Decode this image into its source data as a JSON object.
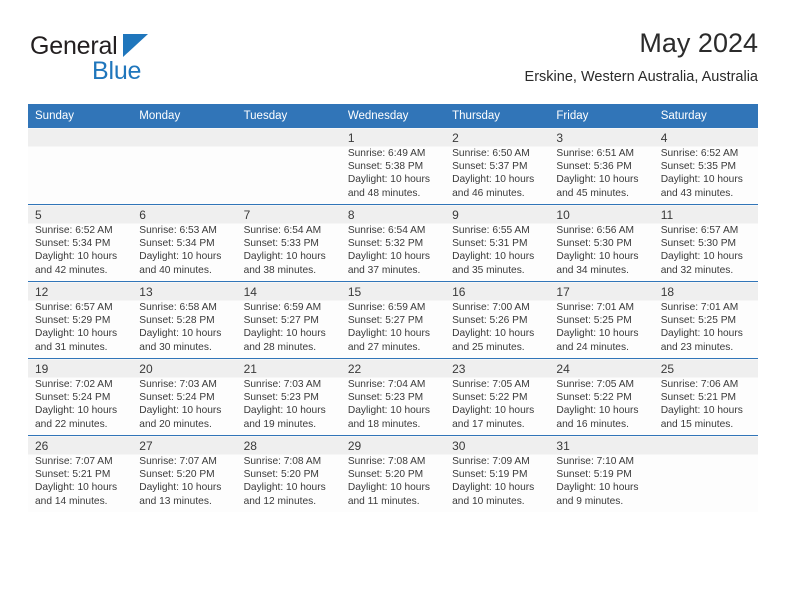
{
  "brand": {
    "name_part1": "General",
    "name_part2": "Blue",
    "triangle_icon": "triangle-icon"
  },
  "header": {
    "title": "May 2024",
    "subtitle": "Erskine, Western Australia, Australia"
  },
  "colors": {
    "header_blue": "#3175b8",
    "brand_blue": "#1f76bc",
    "row_band_gray": "#efefef",
    "text": "#3a3a3a"
  },
  "calendar": {
    "weekday_headers": [
      "Sunday",
      "Monday",
      "Tuesday",
      "Wednesday",
      "Thursday",
      "Friday",
      "Saturday"
    ],
    "weeks": [
      [
        {
          "day": "",
          "empty": true
        },
        {
          "day": "",
          "empty": true
        },
        {
          "day": "",
          "empty": true
        },
        {
          "day": "1",
          "sunrise": "Sunrise: 6:49 AM",
          "sunset": "Sunset: 5:38 PM",
          "daylight1": "Daylight: 10 hours",
          "daylight2": "and 48 minutes."
        },
        {
          "day": "2",
          "sunrise": "Sunrise: 6:50 AM",
          "sunset": "Sunset: 5:37 PM",
          "daylight1": "Daylight: 10 hours",
          "daylight2": "and 46 minutes."
        },
        {
          "day": "3",
          "sunrise": "Sunrise: 6:51 AM",
          "sunset": "Sunset: 5:36 PM",
          "daylight1": "Daylight: 10 hours",
          "daylight2": "and 45 minutes."
        },
        {
          "day": "4",
          "sunrise": "Sunrise: 6:52 AM",
          "sunset": "Sunset: 5:35 PM",
          "daylight1": "Daylight: 10 hours",
          "daylight2": "and 43 minutes."
        }
      ],
      [
        {
          "day": "5",
          "sunrise": "Sunrise: 6:52 AM",
          "sunset": "Sunset: 5:34 PM",
          "daylight1": "Daylight: 10 hours",
          "daylight2": "and 42 minutes."
        },
        {
          "day": "6",
          "sunrise": "Sunrise: 6:53 AM",
          "sunset": "Sunset: 5:34 PM",
          "daylight1": "Daylight: 10 hours",
          "daylight2": "and 40 minutes."
        },
        {
          "day": "7",
          "sunrise": "Sunrise: 6:54 AM",
          "sunset": "Sunset: 5:33 PM",
          "daylight1": "Daylight: 10 hours",
          "daylight2": "and 38 minutes."
        },
        {
          "day": "8",
          "sunrise": "Sunrise: 6:54 AM",
          "sunset": "Sunset: 5:32 PM",
          "daylight1": "Daylight: 10 hours",
          "daylight2": "and 37 minutes."
        },
        {
          "day": "9",
          "sunrise": "Sunrise: 6:55 AM",
          "sunset": "Sunset: 5:31 PM",
          "daylight1": "Daylight: 10 hours",
          "daylight2": "and 35 minutes."
        },
        {
          "day": "10",
          "sunrise": "Sunrise: 6:56 AM",
          "sunset": "Sunset: 5:30 PM",
          "daylight1": "Daylight: 10 hours",
          "daylight2": "and 34 minutes."
        },
        {
          "day": "11",
          "sunrise": "Sunrise: 6:57 AM",
          "sunset": "Sunset: 5:30 PM",
          "daylight1": "Daylight: 10 hours",
          "daylight2": "and 32 minutes."
        }
      ],
      [
        {
          "day": "12",
          "sunrise": "Sunrise: 6:57 AM",
          "sunset": "Sunset: 5:29 PM",
          "daylight1": "Daylight: 10 hours",
          "daylight2": "and 31 minutes."
        },
        {
          "day": "13",
          "sunrise": "Sunrise: 6:58 AM",
          "sunset": "Sunset: 5:28 PM",
          "daylight1": "Daylight: 10 hours",
          "daylight2": "and 30 minutes."
        },
        {
          "day": "14",
          "sunrise": "Sunrise: 6:59 AM",
          "sunset": "Sunset: 5:27 PM",
          "daylight1": "Daylight: 10 hours",
          "daylight2": "and 28 minutes."
        },
        {
          "day": "15",
          "sunrise": "Sunrise: 6:59 AM",
          "sunset": "Sunset: 5:27 PM",
          "daylight1": "Daylight: 10 hours",
          "daylight2": "and 27 minutes."
        },
        {
          "day": "16",
          "sunrise": "Sunrise: 7:00 AM",
          "sunset": "Sunset: 5:26 PM",
          "daylight1": "Daylight: 10 hours",
          "daylight2": "and 25 minutes."
        },
        {
          "day": "17",
          "sunrise": "Sunrise: 7:01 AM",
          "sunset": "Sunset: 5:25 PM",
          "daylight1": "Daylight: 10 hours",
          "daylight2": "and 24 minutes."
        },
        {
          "day": "18",
          "sunrise": "Sunrise: 7:01 AM",
          "sunset": "Sunset: 5:25 PM",
          "daylight1": "Daylight: 10 hours",
          "daylight2": "and 23 minutes."
        }
      ],
      [
        {
          "day": "19",
          "sunrise": "Sunrise: 7:02 AM",
          "sunset": "Sunset: 5:24 PM",
          "daylight1": "Daylight: 10 hours",
          "daylight2": "and 22 minutes."
        },
        {
          "day": "20",
          "sunrise": "Sunrise: 7:03 AM",
          "sunset": "Sunset: 5:24 PM",
          "daylight1": "Daylight: 10 hours",
          "daylight2": "and 20 minutes."
        },
        {
          "day": "21",
          "sunrise": "Sunrise: 7:03 AM",
          "sunset": "Sunset: 5:23 PM",
          "daylight1": "Daylight: 10 hours",
          "daylight2": "and 19 minutes."
        },
        {
          "day": "22",
          "sunrise": "Sunrise: 7:04 AM",
          "sunset": "Sunset: 5:23 PM",
          "daylight1": "Daylight: 10 hours",
          "daylight2": "and 18 minutes."
        },
        {
          "day": "23",
          "sunrise": "Sunrise: 7:05 AM",
          "sunset": "Sunset: 5:22 PM",
          "daylight1": "Daylight: 10 hours",
          "daylight2": "and 17 minutes."
        },
        {
          "day": "24",
          "sunrise": "Sunrise: 7:05 AM",
          "sunset": "Sunset: 5:22 PM",
          "daylight1": "Daylight: 10 hours",
          "daylight2": "and 16 minutes."
        },
        {
          "day": "25",
          "sunrise": "Sunrise: 7:06 AM",
          "sunset": "Sunset: 5:21 PM",
          "daylight1": "Daylight: 10 hours",
          "daylight2": "and 15 minutes."
        }
      ],
      [
        {
          "day": "26",
          "sunrise": "Sunrise: 7:07 AM",
          "sunset": "Sunset: 5:21 PM",
          "daylight1": "Daylight: 10 hours",
          "daylight2": "and 14 minutes."
        },
        {
          "day": "27",
          "sunrise": "Sunrise: 7:07 AM",
          "sunset": "Sunset: 5:20 PM",
          "daylight1": "Daylight: 10 hours",
          "daylight2": "and 13 minutes."
        },
        {
          "day": "28",
          "sunrise": "Sunrise: 7:08 AM",
          "sunset": "Sunset: 5:20 PM",
          "daylight1": "Daylight: 10 hours",
          "daylight2": "and 12 minutes."
        },
        {
          "day": "29",
          "sunrise": "Sunrise: 7:08 AM",
          "sunset": "Sunset: 5:20 PM",
          "daylight1": "Daylight: 10 hours",
          "daylight2": "and 11 minutes."
        },
        {
          "day": "30",
          "sunrise": "Sunrise: 7:09 AM",
          "sunset": "Sunset: 5:19 PM",
          "daylight1": "Daylight: 10 hours",
          "daylight2": "and 10 minutes."
        },
        {
          "day": "31",
          "sunrise": "Sunrise: 7:10 AM",
          "sunset": "Sunset: 5:19 PM",
          "daylight1": "Daylight: 10 hours",
          "daylight2": "and 9 minutes."
        },
        {
          "day": "",
          "empty": true
        }
      ]
    ]
  }
}
